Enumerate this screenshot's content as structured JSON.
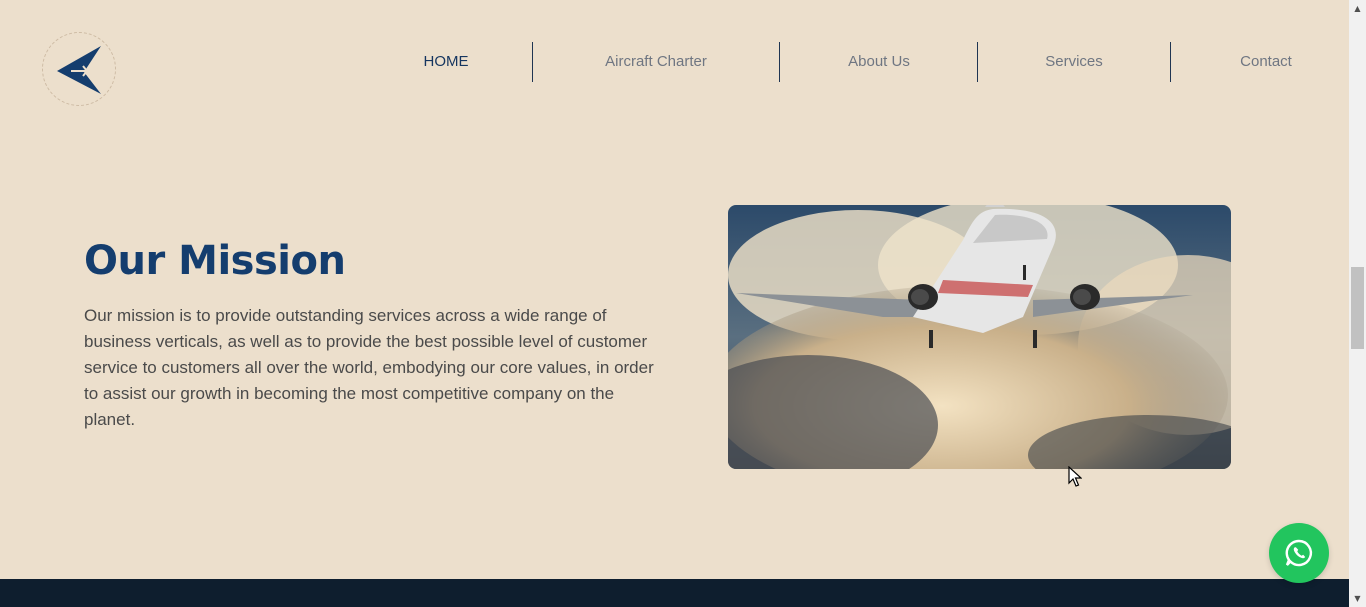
{
  "nav": {
    "items": [
      {
        "label": "HOME",
        "active": true
      },
      {
        "label": "Aircraft Charter",
        "active": false
      },
      {
        "label": "About Us",
        "active": false
      },
      {
        "label": "Services",
        "active": false
      },
      {
        "label": "Contact",
        "active": false
      }
    ]
  },
  "mission": {
    "title": "Our Mission",
    "text": "Our mission is to provide outstanding services across a wide range of business verticals, as well as to provide the best possible level of customer service to customers all over the world, embodying our core values, in order to assist our growth in becoming the most competitive company on the planet."
  },
  "icons": {
    "logo": "paper-plane-logo",
    "whatsapp": "whatsapp-icon",
    "scroll_up": "▲",
    "scroll_down": "▼"
  },
  "colors": {
    "background": "#ecdfcc",
    "brand_navy": "#143d6e",
    "nav_active": "#15355f",
    "nav_inactive": "#6f7682",
    "whatsapp_green": "#22c55e",
    "footer": "#0e1e2e"
  }
}
